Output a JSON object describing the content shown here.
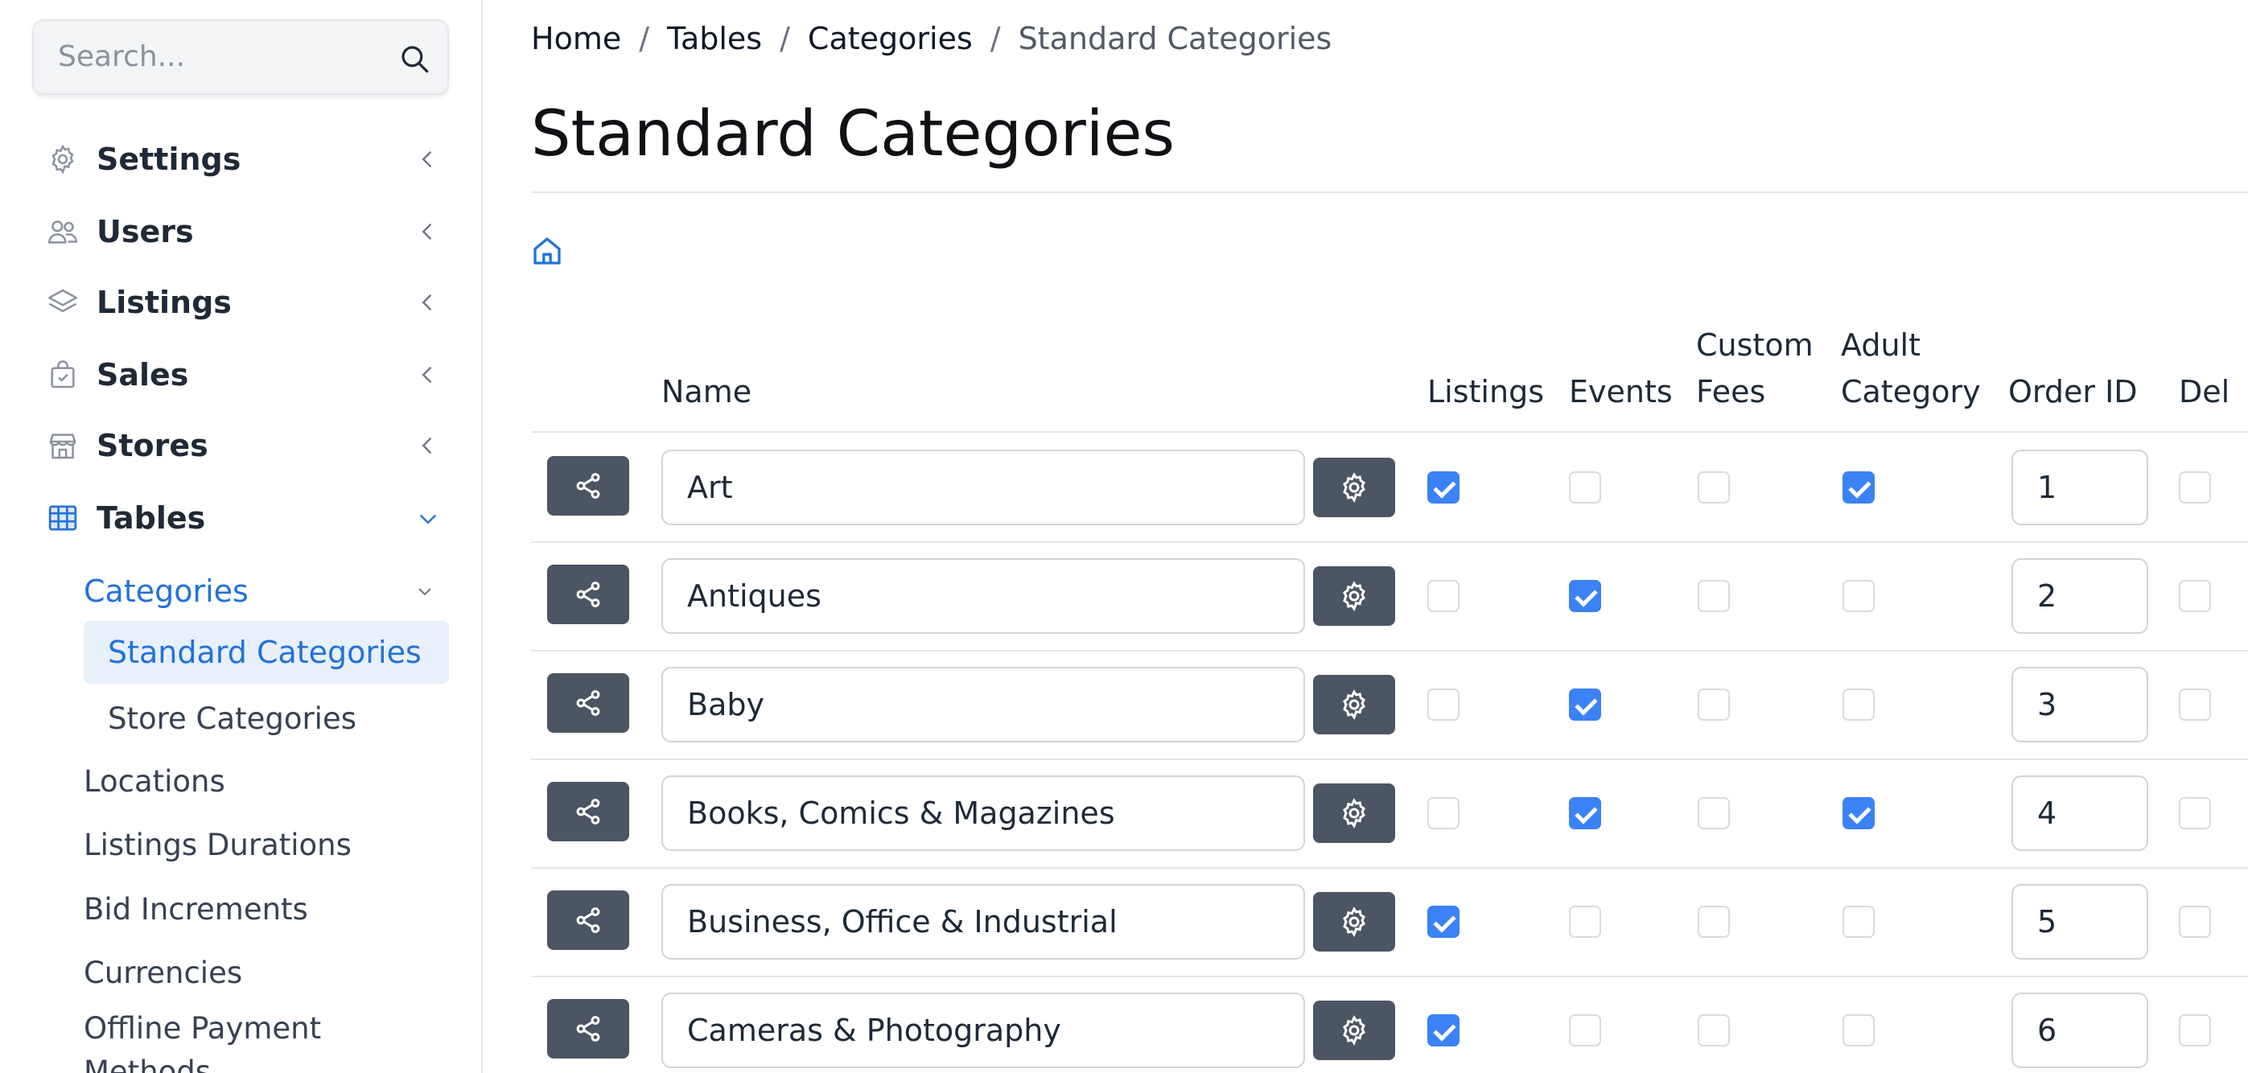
{
  "search": {
    "placeholder": "Search..."
  },
  "sidebar": {
    "items": [
      {
        "label": "Settings",
        "icon": "gear-icon"
      },
      {
        "label": "Users",
        "icon": "users-icon"
      },
      {
        "label": "Listings",
        "icon": "layers-icon"
      },
      {
        "label": "Sales",
        "icon": "shopping-bag-icon"
      },
      {
        "label": "Stores",
        "icon": "store-icon"
      },
      {
        "label": "Tables",
        "icon": "table-icon"
      }
    ],
    "categories_label": "Categories",
    "category_children": [
      "Standard Categories",
      "Store Categories"
    ],
    "table_children": [
      "Locations",
      "Listings Durations",
      "Bid Increments",
      "Currencies",
      "Offline Payment Methods"
    ]
  },
  "breadcrumb": [
    "Home",
    "Tables",
    "Categories",
    "Standard Categories"
  ],
  "page_title": "Standard Categories",
  "table": {
    "headers": {
      "name": "Name",
      "listings": "Listings",
      "events": "Events",
      "custom_fees_1": "Custom",
      "custom_fees_2": "Fees",
      "adult_1": "Adult",
      "adult_2": "Category",
      "order_id": "Order ID",
      "delete": "Del"
    },
    "rows": [
      {
        "name": "Art",
        "listings": true,
        "events": false,
        "custom_fees": false,
        "adult": true,
        "order": "1",
        "delete": false
      },
      {
        "name": "Antiques",
        "listings": false,
        "events": true,
        "custom_fees": false,
        "adult": false,
        "order": "2",
        "delete": false
      },
      {
        "name": "Baby",
        "listings": false,
        "events": true,
        "custom_fees": false,
        "adult": false,
        "order": "3",
        "delete": false
      },
      {
        "name": "Books, Comics & Magazines",
        "listings": false,
        "events": true,
        "custom_fees": false,
        "adult": true,
        "order": "4",
        "delete": false
      },
      {
        "name": "Business, Office & Industrial",
        "listings": true,
        "events": false,
        "custom_fees": false,
        "adult": false,
        "order": "5",
        "delete": false
      },
      {
        "name": "Cameras & Photography",
        "listings": true,
        "events": false,
        "custom_fees": false,
        "adult": false,
        "order": "6",
        "delete": false
      }
    ]
  },
  "colors": {
    "accent": "#2272d9",
    "button": "#4b5563",
    "checkbox_on": "#3b82f6",
    "selected_bg": "#e8f0fc"
  }
}
